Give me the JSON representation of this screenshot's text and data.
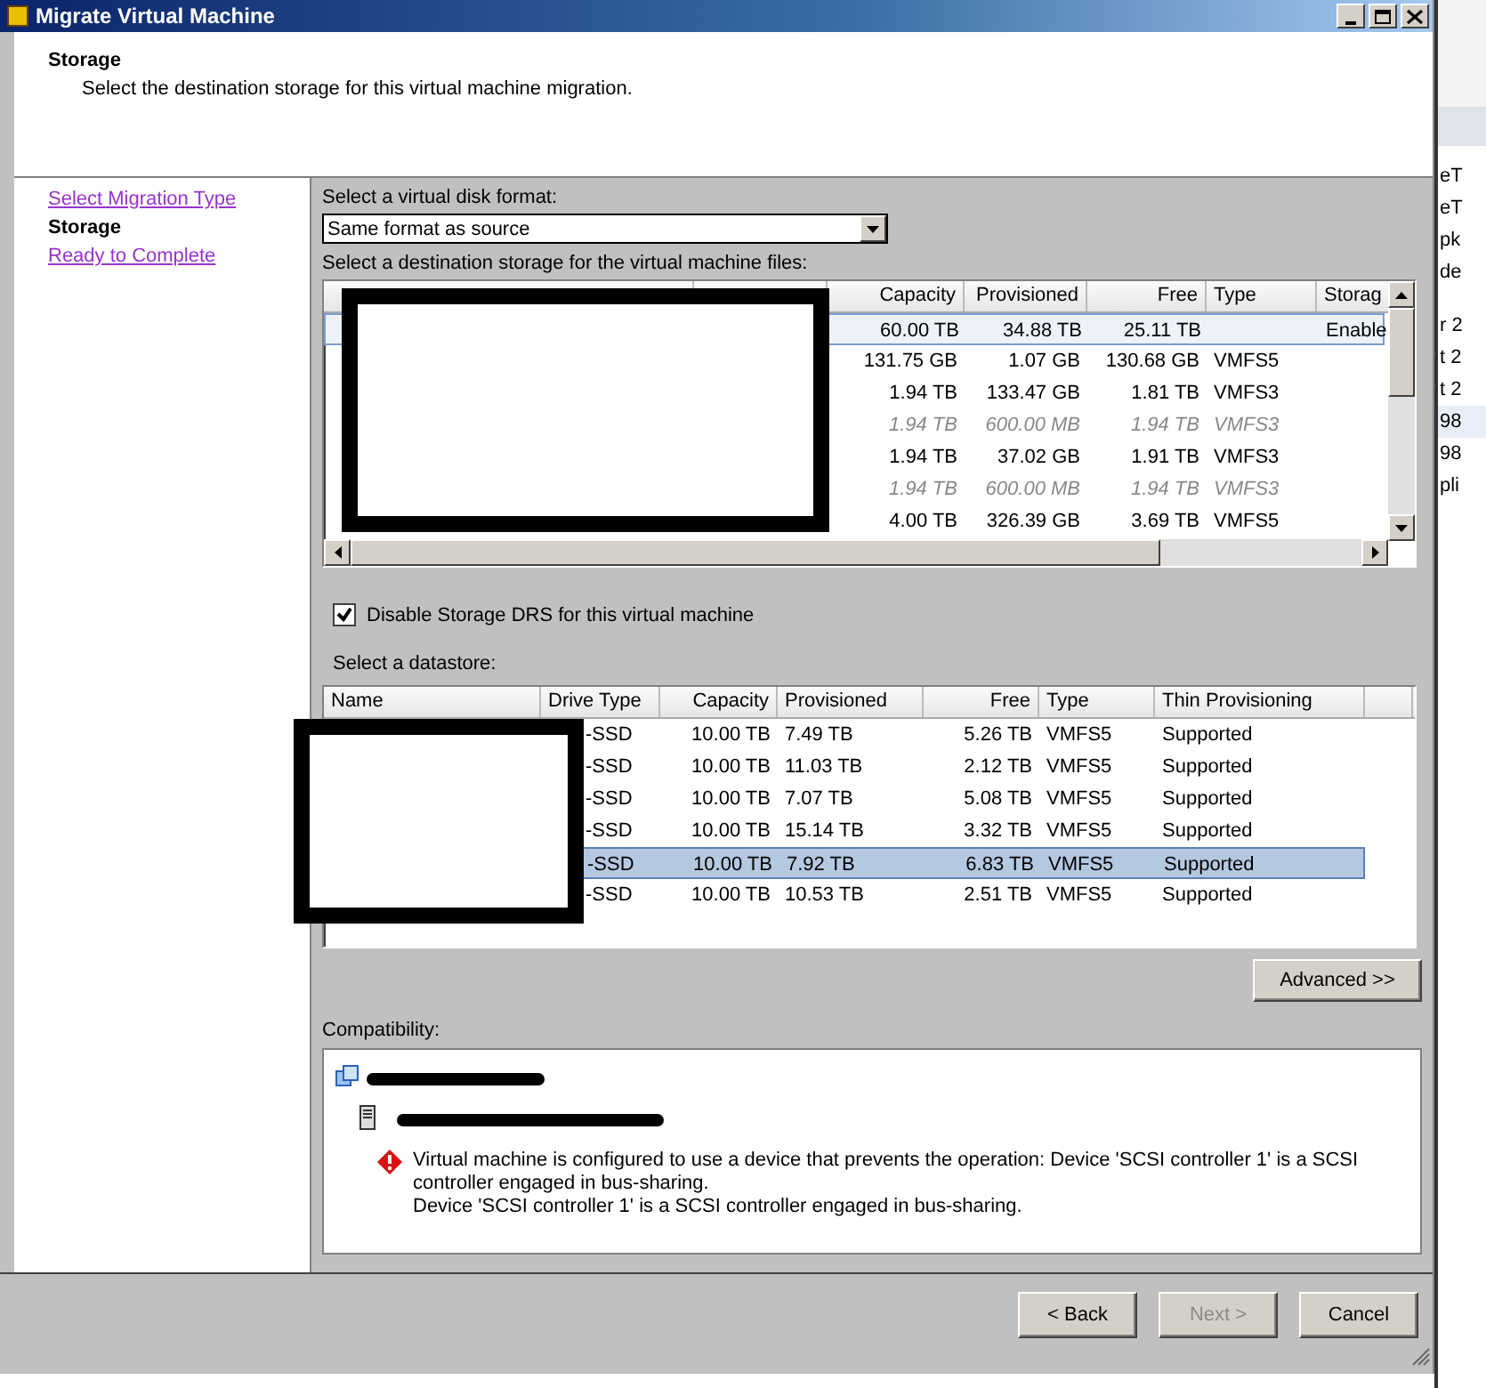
{
  "window": {
    "title": "Migrate Virtual Machine"
  },
  "header": {
    "title": "Storage",
    "description": "Select the destination storage for this virtual machine migration."
  },
  "steps": [
    {
      "label": "Select Migration Type",
      "selected": false
    },
    {
      "label": "Storage",
      "selected": true
    },
    {
      "label": "Ready to Complete",
      "selected": false
    }
  ],
  "disk_format": {
    "label": "Select a virtual disk format:",
    "value": "Same format as source"
  },
  "storage_list": {
    "label": "Select a destination storage for the virtual machine files:",
    "columns": [
      "Capacity",
      "Provisioned",
      "Free",
      "Type",
      "Storag"
    ],
    "rows": [
      {
        "cells": [
          "60.00 TB",
          "34.88 TB",
          "25.11 TB",
          "",
          "Enable"
        ],
        "selected": true,
        "dimmed": false
      },
      {
        "cells": [
          "131.75 GB",
          "1.07 GB",
          "130.68 GB",
          "VMFS5",
          ""
        ],
        "selected": false,
        "dimmed": false
      },
      {
        "cells": [
          "1.94 TB",
          "133.47 GB",
          "1.81 TB",
          "VMFS3",
          ""
        ],
        "selected": false,
        "dimmed": false
      },
      {
        "cells": [
          "1.94 TB",
          "600.00 MB",
          "1.94 TB",
          "VMFS3",
          ""
        ],
        "selected": false,
        "dimmed": true
      },
      {
        "cells": [
          "1.94 TB",
          "37.02 GB",
          "1.91 TB",
          "VMFS3",
          ""
        ],
        "selected": false,
        "dimmed": false
      },
      {
        "cells": [
          "1.94 TB",
          "600.00 MB",
          "1.94 TB",
          "VMFS3",
          ""
        ],
        "selected": false,
        "dimmed": true
      },
      {
        "cells": [
          "4.00 TB",
          "326.39 GB",
          "3.69 TB",
          "VMFS5",
          ""
        ],
        "selected": false,
        "dimmed": false
      }
    ]
  },
  "disable_drs": {
    "label": "Disable Storage DRS for this virtual machine",
    "checked": true
  },
  "datastores": {
    "label": "Select a datastore:",
    "columns": [
      "Name",
      "Drive Type",
      "Capacity",
      "Provisioned",
      "Free",
      "Type",
      "Thin Provisioning"
    ],
    "rows": [
      {
        "cells": [
          "",
          "-SSD",
          "10.00 TB",
          "7.49 TB",
          "5.26 TB",
          "VMFS5",
          "Supported"
        ],
        "selected": false
      },
      {
        "cells": [
          "",
          "-SSD",
          "10.00 TB",
          "11.03 TB",
          "2.12 TB",
          "VMFS5",
          "Supported"
        ],
        "selected": false
      },
      {
        "cells": [
          "",
          "-SSD",
          "10.00 TB",
          "7.07 TB",
          "5.08 TB",
          "VMFS5",
          "Supported"
        ],
        "selected": false
      },
      {
        "cells": [
          "",
          "-SSD",
          "10.00 TB",
          "15.14 TB",
          "3.32 TB",
          "VMFS5",
          "Supported"
        ],
        "selected": false
      },
      {
        "cells": [
          "",
          "-SSD",
          "10.00 TB",
          "7.92 TB",
          "6.83 TB",
          "VMFS5",
          "Supported"
        ],
        "selected": true
      },
      {
        "cells": [
          "",
          "-SSD",
          "10.00 TB",
          "10.53 TB",
          "2.51 TB",
          "VMFS5",
          "Supported"
        ],
        "selected": false
      }
    ]
  },
  "advanced_button": "Advanced >>",
  "compatibility": {
    "label": "Compatibility:",
    "messages": [
      "Virtual machine is configured to use a device that prevents the operation: Device 'SCSI controller 1' is a SCSI controller engaged in bus-sharing.",
      "Device 'SCSI controller 1' is a SCSI controller engaged in bus-sharing."
    ]
  },
  "buttons": [
    {
      "label": "< Back",
      "disabled": false
    },
    {
      "label": "Next >",
      "disabled": true
    },
    {
      "label": "Cancel",
      "disabled": false
    }
  ],
  "background_window": {
    "fragments": [
      "eT",
      "eT",
      "pk",
      "de",
      "r 2",
      "t 2",
      "t 2",
      "98",
      "98",
      "pli"
    ]
  }
}
